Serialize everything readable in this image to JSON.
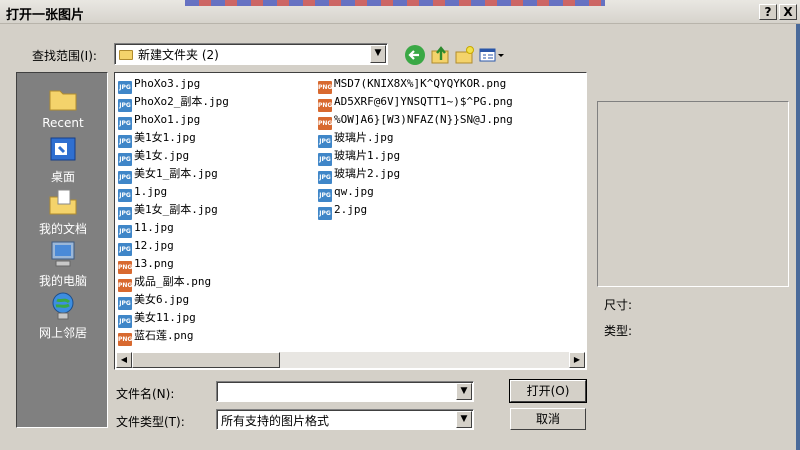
{
  "window": {
    "title": "打开一张图片",
    "help_label": "?",
    "close_label": "X"
  },
  "lookin": {
    "label": "查找范围(I):",
    "value": "新建文件夹 (2)"
  },
  "toolbar": {
    "back_icon": "back-arrow-icon",
    "up_icon": "up-folder-icon",
    "new_folder_icon": "new-folder-icon",
    "view_icon": "view-menu-icon"
  },
  "places": [
    {
      "label": "Recent",
      "icon": "recent-folder-icon"
    },
    {
      "label": "桌面",
      "icon": "desktop-icon"
    },
    {
      "label": "我的文档",
      "icon": "my-documents-icon"
    },
    {
      "label": "我的电脑",
      "icon": "my-computer-icon"
    },
    {
      "label": "网上邻居",
      "icon": "network-icon"
    }
  ],
  "files": {
    "col1": [
      {
        "name": "PhoXo3.jpg",
        "type": "jpg"
      },
      {
        "name": "PhoXo2_副本.jpg",
        "type": "jpg"
      },
      {
        "name": "PhoXo1.jpg",
        "type": "jpg"
      },
      {
        "name": "美1女1.jpg",
        "type": "jpg"
      },
      {
        "name": "美1女.jpg",
        "type": "jpg"
      },
      {
        "name": "美女1_副本.jpg",
        "type": "jpg"
      },
      {
        "name": "1.jpg",
        "type": "jpg"
      },
      {
        "name": "美1女_副本.jpg",
        "type": "jpg"
      },
      {
        "name": "11.jpg",
        "type": "jpg"
      },
      {
        "name": "12.jpg",
        "type": "jpg"
      },
      {
        "name": "13.png",
        "type": "png"
      },
      {
        "name": "成品_副本.png",
        "type": "png"
      },
      {
        "name": "美女6.jpg",
        "type": "jpg"
      },
      {
        "name": "美女11.jpg",
        "type": "jpg"
      },
      {
        "name": "蓝石莲.png",
        "type": "png"
      }
    ],
    "col2": [
      {
        "name": "MSD7(KNIX8X%]K^QYQYKOR.png",
        "type": "png"
      },
      {
        "name": "AD5XRF@6V]YNSQTT1~)$^PG.png",
        "type": "png"
      },
      {
        "name": "%OW]A6}[W3)NFAZ(N}}SN@J.png",
        "type": "png"
      },
      {
        "name": "玻璃片.jpg",
        "type": "jpg"
      },
      {
        "name": "玻璃片1.jpg",
        "type": "jpg"
      },
      {
        "name": "玻璃片2.jpg",
        "type": "jpg"
      },
      {
        "name": "qw.jpg",
        "type": "jpg"
      },
      {
        "name": "2.jpg",
        "type": "jpg"
      }
    ]
  },
  "preview": {
    "size_label": "尺寸:",
    "type_label": "类型:"
  },
  "filename": {
    "label": "文件名(N):",
    "value": ""
  },
  "filetype": {
    "label": "文件类型(T):",
    "value": "所有支持的图片格式"
  },
  "buttons": {
    "open": "打开(O)",
    "cancel": "取消"
  }
}
